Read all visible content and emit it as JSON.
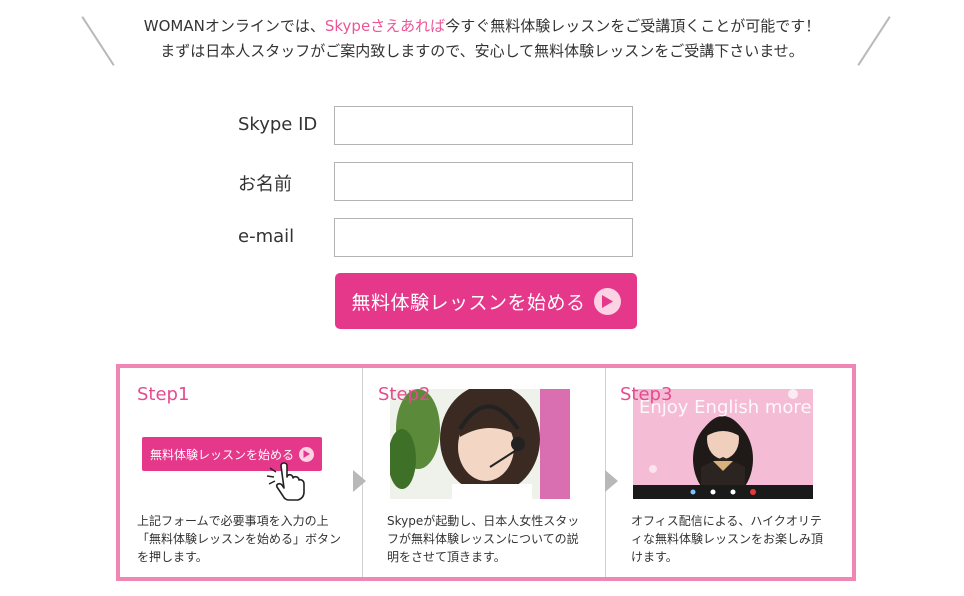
{
  "intro": {
    "line1_before": "WOMANオンラインでは、",
    "line1_highlight": "Skypeさえあれば",
    "line1_after": "今すぐ無料体験レッスンをご受講頂くことが可能です！",
    "line2": "まずは日本人スタッフがご案内致しますので、安心して無料体験レッスンをご受講下さいませ。"
  },
  "form": {
    "skype_label": "Skype ID",
    "skype_value": "",
    "name_label": "お名前",
    "name_value": "",
    "email_label": "e-mail",
    "email_value": "",
    "submit_label": "無料体験レッスンを始める"
  },
  "steps": [
    {
      "title": "Step1",
      "button_label": "無料体験レッスンを始める",
      "text_lines": [
        "上記フォームで必要事項を入力の上",
        "「無料体験レッスンを始める」ボタン",
        "を押します。"
      ]
    },
    {
      "title": "Step2",
      "text_lines": [
        "Skypeが起動し、日本人女性スタッ",
        "フが無料体験レッスンについての説",
        "明をさせて頂きます。"
      ]
    },
    {
      "title": "Step3",
      "photo_caption": "Enjoy English more!",
      "text_lines": [
        "オフィス配信による、ハイクオリテ",
        "ィな無料体験レッスンをお楽しみ頂",
        "けます。"
      ]
    }
  ],
  "colors": {
    "accent": "#e6388a",
    "highlight_text": "#ec5596",
    "panel_border": "#f086b4",
    "step_title": "#e44c90"
  },
  "icons": [
    "play-icon",
    "pointer-hand-icon",
    "arrow-right-icon",
    "headset-icon"
  ]
}
